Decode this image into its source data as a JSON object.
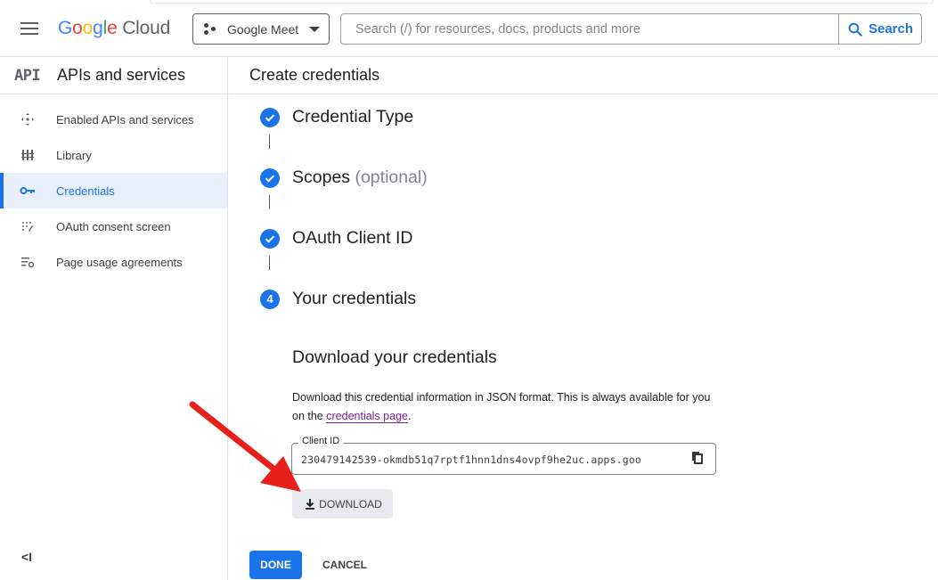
{
  "header": {
    "logo_google": "Google",
    "logo_cloud": "Cloud",
    "project_name": "Google Meet",
    "search_placeholder": "Search (/) for resources, docs, products and more",
    "search_button": "Search"
  },
  "sidebar": {
    "badge": "API",
    "title": "APIs and services",
    "items": [
      {
        "label": "Enabled APIs and services",
        "icon": "enabled-apis-icon",
        "active": false
      },
      {
        "label": "Library",
        "icon": "library-icon",
        "active": false
      },
      {
        "label": "Credentials",
        "icon": "key-icon",
        "active": true
      },
      {
        "label": "OAuth consent screen",
        "icon": "oauth-icon",
        "active": false
      },
      {
        "label": "Page usage agreements",
        "icon": "settings-list-icon",
        "active": false
      }
    ],
    "collapse_label": "<I"
  },
  "main": {
    "page_title": "Create credentials",
    "steps": [
      {
        "title": "Credential Type",
        "suffix": "",
        "state": "done"
      },
      {
        "title": "Scopes",
        "suffix": "(optional)",
        "state": "done"
      },
      {
        "title": "OAuth Client ID",
        "suffix": "",
        "state": "done"
      },
      {
        "title": "Your credentials",
        "suffix": "",
        "state": "current",
        "number": "4"
      }
    ],
    "download_title": "Download your credentials",
    "download_desc_before": "Download this credential information in JSON format. This is always available for you on the",
    "download_desc_link": "credentials page",
    "download_desc_after": ".",
    "client_id_label": "Client ID",
    "client_id_value": "230479142539-okmdb51q7rptf1hnn1dns4ovpf9he2uc.apps.goo",
    "download_button": "DOWNLOAD",
    "done_button": "DONE",
    "cancel_button": "CANCEL"
  },
  "colors": {
    "accent": "#1a73e8",
    "annotation_arrow": "#e8201c"
  }
}
